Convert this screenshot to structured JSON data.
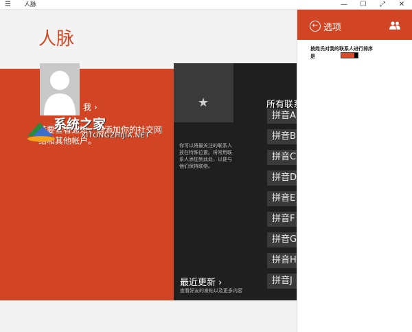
{
  "window": {
    "menu_icon": "menu-icon",
    "menu_glyph": "☰",
    "title": "人脉",
    "controls": {
      "minimize": "—",
      "maximize": "☐",
      "fullscreen": "⤢",
      "close": "✕"
    }
  },
  "app": {
    "title": "人脉",
    "me": {
      "label": "我 ›",
      "description": "若要查看通知，请添加你的社交网络和其他帐户。"
    },
    "favorites": {
      "star": "★",
      "description": "你可以将最关注的联系人放在特殊位置。将常用联系人添加到此处，以便与他们保持联络。"
    },
    "all_contacts": {
      "title": "所有联系人",
      "groups": [
        "拼音A",
        "拼音B",
        "拼音C",
        "拼音D",
        "拼音E",
        "拼音F",
        "拼音G",
        "拼音H",
        "拼音J"
      ]
    },
    "recent": {
      "title": "最近更新 ›",
      "subtitle": "查看好友的发帖以及更多内容"
    }
  },
  "watermark": {
    "text": "系统之家",
    "url": "XITONGZHIJIA.NET"
  },
  "settings": {
    "back_glyph": "←",
    "title": "选项",
    "sort_label": "按姓氏对我的联系人进行排序",
    "sort_value": "是",
    "sort_on": true
  },
  "colors": {
    "accent": "#d14524",
    "dark": "#1f1f1f",
    "tile": "#3a3a3a"
  }
}
